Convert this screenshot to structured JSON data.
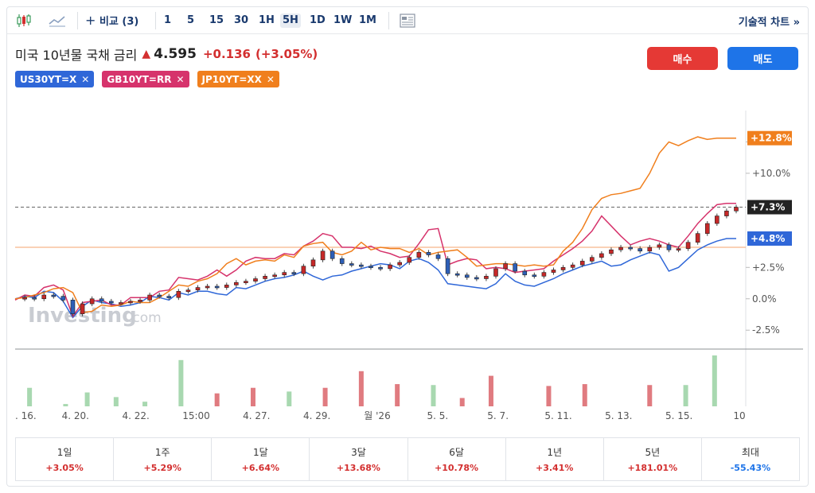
{
  "toolbar": {
    "compare_label": "비교 (3)",
    "intervals": [
      "1",
      "5",
      "15",
      "30",
      "1H",
      "5H",
      "1D",
      "1W",
      "1M"
    ],
    "active_interval": "5H",
    "tech_chart_label": "기술적 차트 »"
  },
  "header": {
    "title": "미국 10년물 국채 금리",
    "price": "4.595",
    "change": "+0.136",
    "change_pct": "(+3.05%)",
    "buy_label": "매수",
    "sell_label": "매도"
  },
  "compare_chips": [
    {
      "label": "US30YT=X",
      "color": "#2f67d8"
    },
    {
      "label": "GB10YT=RR",
      "color": "#d6336c"
    },
    {
      "label": "JP10YT=XX",
      "color": "#f07f1d"
    }
  ],
  "watermark": {
    "main": "Investing",
    "suffix": ".com"
  },
  "chart_data": {
    "type": "line",
    "ylim": [
      -3.5,
      15
    ],
    "y_ticks": [
      {
        "v": 12.5,
        "label": "+12.8%"
      },
      {
        "v": 10.0,
        "label": "+10.0%"
      },
      {
        "v": 2.5,
        "label": "+2.5%"
      },
      {
        "v": 0.0,
        "label": "0.0%"
      },
      {
        "v": -2.5,
        "label": "-2.5%"
      }
    ],
    "x_labels": [
      ". 16.",
      "4. 20.",
      "4. 22.",
      "15:00",
      "4. 27.",
      "4. 29.",
      "월 '26",
      "5. 5.",
      "5. 7.",
      "5. 11.",
      "5. 13.",
      "5. 15.",
      "10"
    ],
    "end_labels": [
      {
        "series": "JP10YT=XX",
        "label": "+12.8%",
        "value": 12.8,
        "color": "#f07f1d"
      },
      {
        "series": "US10Y",
        "label": "+7.3%",
        "value": 7.3,
        "color": "#222222"
      },
      {
        "series": "US30YT=X",
        "label": "+4.8%",
        "value": 4.8,
        "color": "#2f67d8"
      }
    ],
    "reference_line": 7.3,
    "reference_line_2": 4.1,
    "series": [
      {
        "name": "US30YT=X",
        "color": "#2f67d8",
        "values": [
          0.0,
          0.2,
          0.1,
          0.6,
          0.5,
          -0.2,
          -1.5,
          -0.6,
          -0.1,
          -0.3,
          -0.4,
          -0.6,
          -0.5,
          -0.3,
          0.2,
          0.1,
          -0.1,
          0.5,
          0.3,
          0.6,
          0.6,
          0.4,
          0.3,
          0.9,
          0.8,
          1.1,
          1.4,
          1.6,
          1.7,
          1.9,
          2.2,
          1.8,
          1.5,
          1.8,
          1.9,
          2.2,
          2.4,
          2.6,
          2.8,
          2.7,
          2.4,
          3.0,
          3.2,
          2.9,
          2.3,
          1.2,
          1.1,
          1.0,
          0.9,
          0.8,
          1.2,
          2.0,
          1.4,
          1.1,
          1.0,
          1.3,
          1.6,
          2.0,
          2.3,
          2.6,
          2.8,
          3.0,
          2.6,
          2.7,
          3.1,
          3.4,
          3.7,
          3.5,
          2.2,
          2.5,
          3.2,
          3.9,
          4.3,
          4.6,
          4.8,
          4.8
        ]
      },
      {
        "name": "GB10YT=RR",
        "color": "#d6336c",
        "values": [
          -0.1,
          0.3,
          0.2,
          0.9,
          1.1,
          0.7,
          -1.4,
          -0.3,
          -0.2,
          -0.1,
          -0.5,
          -0.5,
          0.1,
          0.1,
          0.1,
          0.6,
          0.7,
          1.7,
          1.6,
          1.5,
          1.8,
          2.3,
          1.8,
          2.3,
          3.0,
          3.3,
          3.2,
          3.2,
          3.6,
          3.5,
          4.2,
          4.6,
          5.2,
          5.0,
          4.1,
          4.1,
          4.0,
          4.2,
          3.8,
          3.6,
          3.3,
          3.4,
          4.4,
          5.5,
          5.6,
          2.7,
          3.0,
          3.2,
          3.1,
          2.4,
          2.5,
          2.4,
          2.1,
          2.2,
          2.3,
          2.4,
          3.0,
          3.5,
          4.0,
          4.6,
          5.4,
          6.6,
          5.8,
          5.0,
          4.3,
          4.6,
          4.8,
          4.6,
          4.3,
          4.1,
          5.0,
          6.0,
          6.8,
          7.5,
          7.6,
          7.6
        ]
      },
      {
        "name": "JP10YT=XX",
        "color": "#f07f1d",
        "values": [
          0.0,
          0.1,
          0.3,
          0.5,
          0.8,
          0.9,
          0.5,
          -1.1,
          -1.0,
          -0.5,
          -0.6,
          -0.5,
          -0.2,
          -0.3,
          -0.3,
          0.1,
          0.6,
          1.1,
          1.0,
          1.4,
          1.6,
          2.0,
          2.8,
          3.2,
          2.7,
          3.0,
          3.1,
          3.0,
          3.5,
          3.3,
          4.2,
          4.4,
          4.5,
          3.7,
          3.5,
          3.8,
          4.5,
          3.9,
          4.1,
          4.0,
          4.0,
          3.7,
          4.0,
          3.5,
          3.7,
          3.8,
          3.9,
          3.3,
          2.6,
          2.7,
          2.8,
          2.8,
          2.7,
          2.6,
          2.7,
          2.6,
          2.7,
          3.8,
          4.5,
          5.6,
          7.1,
          8.0,
          8.3,
          8.4,
          8.6,
          8.8,
          10.0,
          11.6,
          12.5,
          12.2,
          12.6,
          12.9,
          12.7,
          12.8,
          12.8,
          12.8
        ]
      },
      {
        "name": "US10Y",
        "color": "#333333",
        "type": "candle",
        "values": [
          0.0,
          0.1,
          0.0,
          0.3,
          0.2,
          -0.1,
          -1.2,
          -0.4,
          0.0,
          -0.2,
          -0.3,
          -0.3,
          -0.2,
          -0.1,
          0.3,
          0.2,
          0.1,
          0.6,
          0.7,
          0.9,
          1.0,
          0.9,
          1.1,
          1.3,
          1.4,
          1.6,
          1.8,
          1.9,
          2.1,
          2.0,
          2.6,
          3.1,
          3.8,
          3.2,
          2.8,
          2.7,
          2.6,
          2.5,
          2.4,
          2.7,
          2.9,
          3.3,
          3.7,
          3.5,
          3.2,
          2.0,
          1.9,
          1.7,
          1.6,
          1.8,
          2.4,
          2.8,
          2.2,
          1.9,
          1.8,
          2.1,
          2.3,
          2.5,
          2.7,
          3.0,
          3.3,
          3.6,
          3.9,
          4.1,
          4.0,
          3.8,
          4.1,
          4.3,
          3.9,
          4.0,
          4.5,
          5.2,
          6.0,
          6.6,
          7.0,
          7.3
        ]
      }
    ],
    "volume": [
      {
        "x": 2,
        "v": 40,
        "dir": "up"
      },
      {
        "x": 7,
        "v": 5,
        "dir": "up"
      },
      {
        "x": 10,
        "v": 30,
        "dir": "up"
      },
      {
        "x": 14,
        "v": 20,
        "dir": "up"
      },
      {
        "x": 18,
        "v": 10,
        "dir": "up"
      },
      {
        "x": 23,
        "v": 100,
        "dir": "up"
      },
      {
        "x": 28,
        "v": 28,
        "dir": "down"
      },
      {
        "x": 33,
        "v": 40,
        "dir": "down"
      },
      {
        "x": 38,
        "v": 32,
        "dir": "up"
      },
      {
        "x": 43,
        "v": 40,
        "dir": "down"
      },
      {
        "x": 48,
        "v": 76,
        "dir": "down"
      },
      {
        "x": 53,
        "v": 48,
        "dir": "down"
      },
      {
        "x": 58,
        "v": 46,
        "dir": "up"
      },
      {
        "x": 62,
        "v": 18,
        "dir": "down"
      },
      {
        "x": 66,
        "v": 66,
        "dir": "down"
      },
      {
        "x": 74,
        "v": 44,
        "dir": "down"
      },
      {
        "x": 79,
        "v": 48,
        "dir": "down"
      },
      {
        "x": 88,
        "v": 46,
        "dir": "down"
      },
      {
        "x": 93,
        "v": 46,
        "dir": "up"
      },
      {
        "x": 97,
        "v": 110,
        "dir": "up"
      }
    ]
  },
  "performance": [
    {
      "label": "1일",
      "value": "+3.05%",
      "dir": "up"
    },
    {
      "label": "1주",
      "value": "+5.29%",
      "dir": "up"
    },
    {
      "label": "1달",
      "value": "+6.64%",
      "dir": "up"
    },
    {
      "label": "3달",
      "value": "+13.68%",
      "dir": "up"
    },
    {
      "label": "6달",
      "value": "+10.78%",
      "dir": "up"
    },
    {
      "label": "1년",
      "value": "+3.41%",
      "dir": "up"
    },
    {
      "label": "5년",
      "value": "+181.01%",
      "dir": "up"
    },
    {
      "label": "최대",
      "value": "-55.43%",
      "dir": "down"
    }
  ]
}
